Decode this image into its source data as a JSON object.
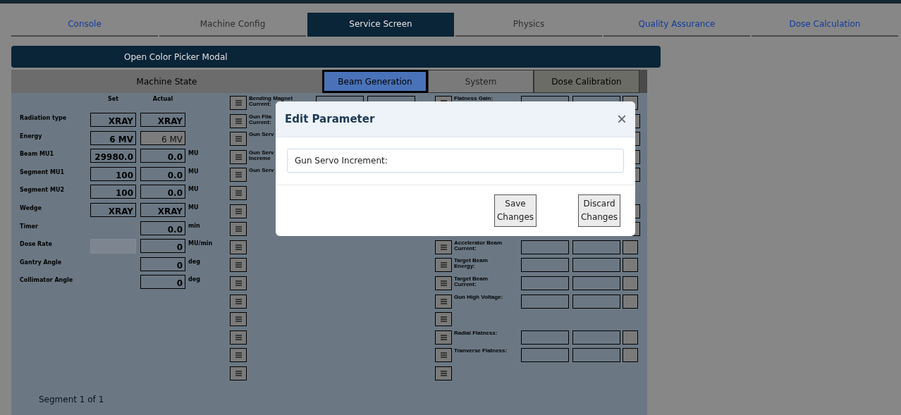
{
  "tabs": [
    {
      "label": "Console",
      "selected": false,
      "disabled": false
    },
    {
      "label": "Machine Config",
      "selected": false,
      "disabled": true
    },
    {
      "label": "Service Screen",
      "selected": true,
      "disabled": false
    },
    {
      "label": "Physics",
      "selected": false,
      "disabled": true
    },
    {
      "label": "Quality Assurance",
      "selected": false,
      "disabled": false
    },
    {
      "label": "Dose Calculation",
      "selected": false,
      "disabled": false
    }
  ],
  "color_picker_button": "Open Color Picker Modal",
  "sub_tabs": [
    {
      "label": "Machine State",
      "kind": "state"
    },
    {
      "label": "Beam Generation",
      "kind": "tab",
      "selected": true,
      "disabled": false
    },
    {
      "label": "System",
      "kind": "tab",
      "selected": false,
      "disabled": true
    },
    {
      "label": "Dose Calibration",
      "kind": "tab",
      "selected": false,
      "disabled": false
    }
  ],
  "machine_state": {
    "columns": [
      "Set",
      "Actual"
    ],
    "rows": [
      {
        "label": "Radiation type",
        "set": "XRAY",
        "actual": "XRAY",
        "actual_disabled": false
      },
      {
        "label": "Energy",
        "set": "6 MV",
        "actual": "6 MV",
        "actual_disabled": true
      },
      {
        "label": "Beam MU1",
        "set": "29980.0",
        "actual": "0.0",
        "unit": "MU",
        "actual_disabled": false
      },
      {
        "label": "Segment MU1",
        "set": "100",
        "actual": "0.0",
        "unit": "MU",
        "actual_disabled": false
      },
      {
        "label": "Segment MU2",
        "set": "100",
        "actual": "0.0",
        "unit": "MU",
        "actual_disabled": false
      },
      {
        "label": "Wedge",
        "set": "XRAY",
        "actual": "XRAY",
        "unit": "MU",
        "actual_disabled": false
      },
      {
        "label": "Timer",
        "actual": "0.0",
        "unit": "min",
        "actual_disabled": false
      },
      {
        "label": "Dose Rate",
        "actual": "0",
        "unit": "MU/min",
        "set_disabled": true,
        "actual_disabled": false
      },
      {
        "label": "Gantry Angle",
        "actual": "0",
        "unit": "deg",
        "actual_disabled": false
      },
      {
        "label": "Collimator Angle",
        "actual": "0",
        "unit": "deg",
        "actual_disabled": false
      }
    ],
    "footer": "Segment 1 of 1"
  },
  "parameters_left": [
    {
      "label": "Bending Magnet\nCurrent:",
      "kind": "param"
    },
    {
      "label": "Gun Fila\nCurrent:",
      "kind": "hidden"
    },
    {
      "label": "Gun Serv",
      "kind": "hidden"
    },
    {
      "label": "Gun Serv\nIncreme",
      "kind": "hidden"
    },
    {
      "label": "Gun Serv",
      "kind": "hidden"
    },
    {
      "kind": "blank"
    },
    {
      "kind": "blank"
    },
    {
      "kind": "blank"
    },
    {
      "kind": "blank"
    },
    {
      "kind": "blank"
    },
    {
      "kind": "blank"
    },
    {
      "kind": "blank"
    },
    {
      "kind": "blank"
    },
    {
      "kind": "blank"
    },
    {
      "kind": "blank"
    },
    {
      "kind": "blank"
    }
  ],
  "parameters_right": [
    {
      "label": "Flatness Gain:",
      "kind": "param"
    },
    {
      "kind": "edge"
    },
    {
      "kind": "edge"
    },
    {
      "kind": "edge"
    },
    {
      "kind": "edge"
    },
    {
      "kind": "covered"
    },
    {
      "kind": "edge"
    },
    {
      "kind": "edge"
    },
    {
      "label": "Accelerator Beam\nCurrent:",
      "kind": "param"
    },
    {
      "label": "Target Beam\nEnergy:",
      "kind": "param"
    },
    {
      "label": "Target Beam\nCurrent:",
      "kind": "param"
    },
    {
      "label": "Gun High Voltage:",
      "kind": "param"
    },
    {
      "kind": "blank"
    },
    {
      "label": "Radial Flatness:",
      "kind": "param"
    },
    {
      "label": "Tranverse Flatness:",
      "kind": "param"
    },
    {
      "kind": "blank"
    }
  ],
  "modal": {
    "title": "Edit Parameter",
    "close": "×",
    "field_value": "Gun Servo Increment:",
    "buttons": [
      "Save\nChanges",
      "Discard\nChanges"
    ]
  }
}
